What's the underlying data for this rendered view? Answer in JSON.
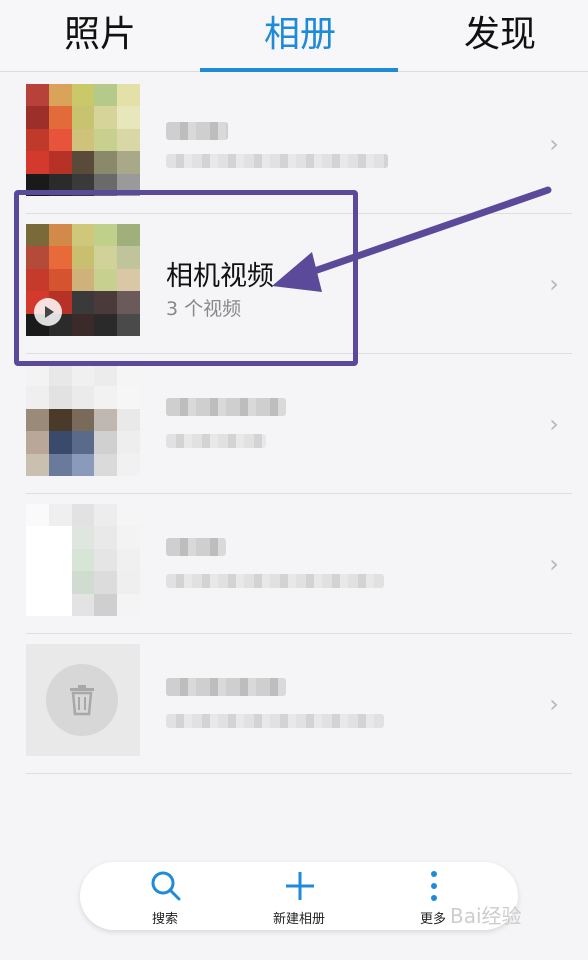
{
  "tabs": [
    {
      "label": "照片",
      "active": false
    },
    {
      "label": "相册",
      "active": true
    },
    {
      "label": "发现",
      "active": false
    }
  ],
  "colors": {
    "accent": "#1f8bd8",
    "annotation": "#5b4a9a"
  },
  "albums": [
    {
      "name": "",
      "count": "",
      "blurred": true
    },
    {
      "name": "相机视频",
      "count": "3 个视频",
      "blurred": false,
      "video": true
    },
    {
      "name": "",
      "count": "",
      "blurred": true
    },
    {
      "name": "",
      "count": "",
      "blurred": true
    },
    {
      "name": "",
      "count": "",
      "blurred": true,
      "icon": "trash-icon"
    }
  ],
  "bottom_bar": {
    "search_label": "搜索",
    "new_album_label": "新建相册",
    "more_label": "更多"
  },
  "watermark": "Bai经验"
}
